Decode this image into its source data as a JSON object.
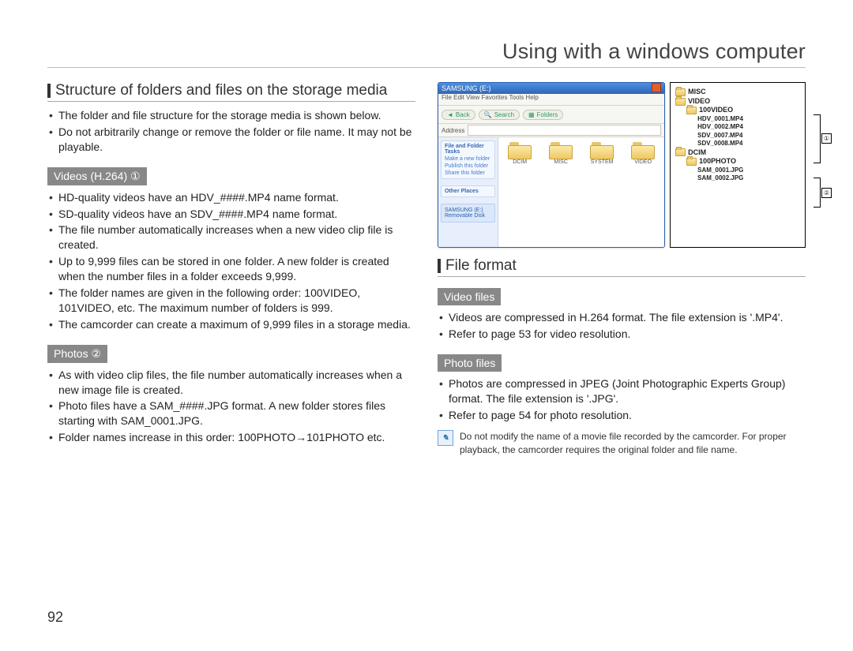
{
  "page": {
    "title": "Using with a windows computer",
    "number": "92"
  },
  "left": {
    "section_title": "Structure of folders and files on the storage media",
    "intro_bullets": [
      "The folder and file structure for the storage media is shown below.",
      "Do not arbitrarily change or remove the folder or file name. It may not be playable."
    ],
    "videos_header": "Videos (H.264) ①",
    "videos_bullets": [
      "HD-quality videos have an HDV_####.MP4 name format.",
      "SD-quality videos have an SDV_####.MP4 name format.",
      "The file number automatically increases when a new video clip file is created.",
      "Up to 9,999 files can be stored in one folder. A new folder is created when the number files in a folder exceeds 9,999.",
      "The folder names are given in the following order: 100VIDEO, 101VIDEO, etc. The maximum number of folders is 999.",
      "The camcorder can create a maximum of 9,999 files in a storage media."
    ],
    "photos_header": "Photos ②",
    "photos_bullets": [
      "As with video clip files, the file number automatically increases when a new image file is created.",
      "Photo files have a SAM_####.JPG format. A new folder stores files starting with SAM_0001.JPG.",
      "Folder names increase in this order: 100PHOTO→101PHOTO etc."
    ]
  },
  "explorer": {
    "title": "SAMSUNG (E:)",
    "menu": "File  Edit  View  Favorites  Tools  Help",
    "back": "Back",
    "search": "Search",
    "folders": "Folders",
    "address_label": "Address",
    "side": {
      "tasks_title": "File and Folder Tasks",
      "task1": "Make a new folder",
      "task2": "Publish this folder",
      "task3": "Share this folder",
      "other_title": "Other Places",
      "details_title": "SAMSUNG (E:)",
      "details_sub": "Removable Disk"
    },
    "pane_folders": [
      "DCIM",
      "MISC",
      "SYSTEM",
      "VIDEO"
    ]
  },
  "tree": {
    "root_misc": "MISC",
    "root_video": "VIDEO",
    "video_sub": "100VIDEO",
    "video_files": [
      "HDV_0001.MP4",
      "HDV_0002.MP4",
      "SDV_0007.MP4",
      "SDV_0008.MP4"
    ],
    "root_dcim": "DCIM",
    "dcim_sub": "100PHOTO",
    "dcim_files": [
      "SAM_0001.JPG",
      "SAM_0002.JPG"
    ],
    "marker1": "①",
    "marker2": "②"
  },
  "right": {
    "section_title": "File format",
    "video_header": "Video files",
    "video_bullets": [
      "Videos are compressed in H.264 format. The file extension is '.MP4'.",
      "Refer to page 53 for video resolution."
    ],
    "photo_header": "Photo files",
    "photo_bullets": [
      "Photos are compressed in JPEG (Joint Photographic Experts Group) format. The file extension is '.JPG'.",
      "Refer to page 54 for photo resolution."
    ],
    "note": "Do not modify the name of a movie file recorded by the camcorder. For proper playback, the camcorder requires the original folder and file name."
  }
}
